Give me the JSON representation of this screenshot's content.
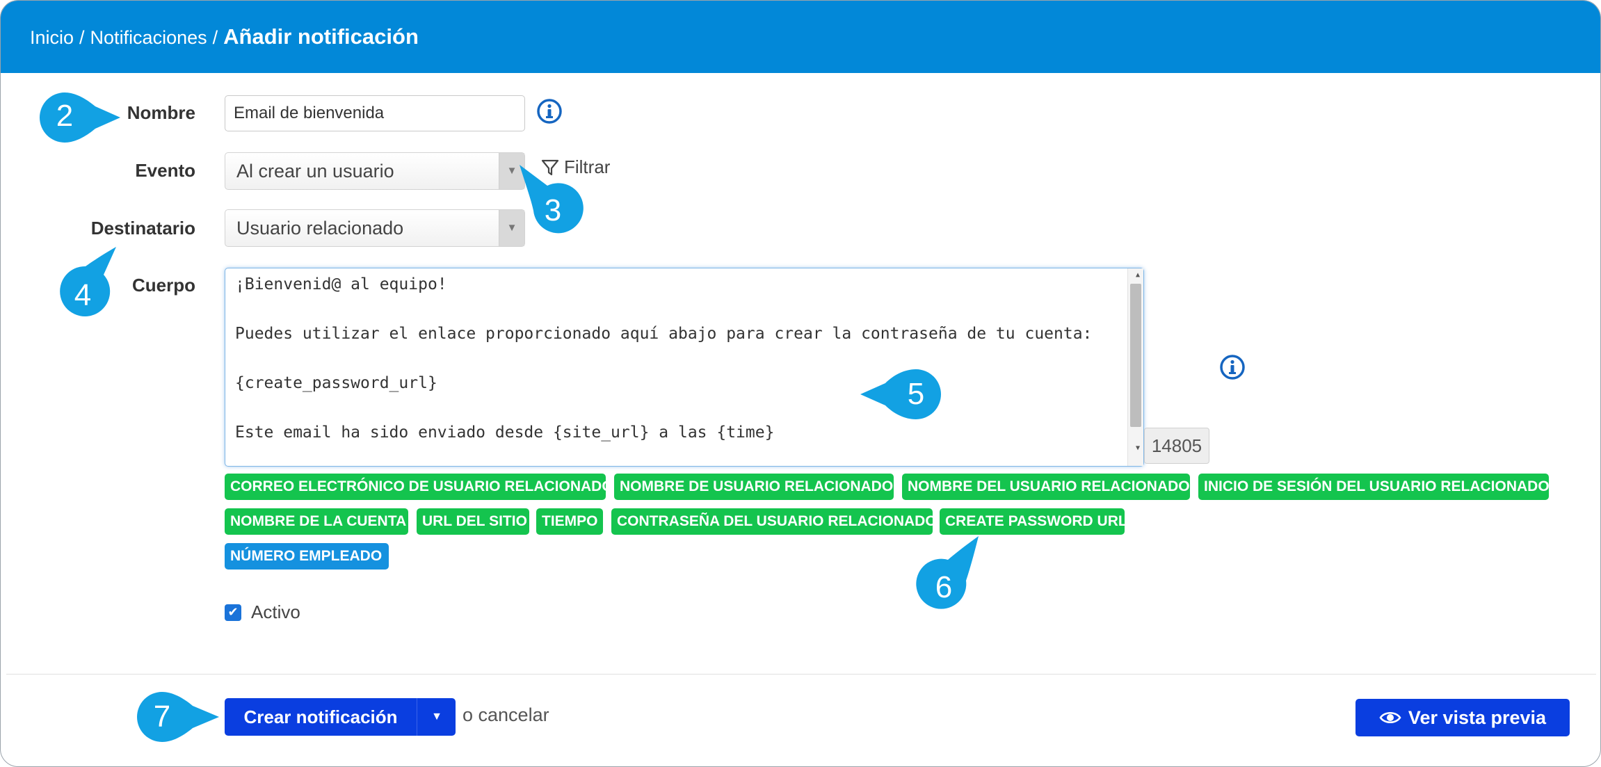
{
  "breadcrumb": {
    "home": "Inicio",
    "section": "Notificaciones",
    "separator": "/",
    "current": "Añadir notificación"
  },
  "form": {
    "name": {
      "label": "Nombre",
      "value": "Email de bienvenida"
    },
    "event": {
      "label": "Evento",
      "value": "Al crear un usuario",
      "filter_label": "Filtrar"
    },
    "recipient": {
      "label": "Destinatario",
      "value": "Usuario relacionado"
    },
    "body": {
      "label": "Cuerpo",
      "lines": [
        "¡Bienvenid@ al equipo!",
        "Puedes utilizar el enlace proporcionado aquí abajo para crear la contraseña de tu cuenta:",
        "{create_password_url}",
        "Este email ha sido enviado desde {site_url} a las {time}"
      ],
      "char_count": "14805"
    },
    "tags": [
      "CORREO ELECTRÓNICO DE USUARIO RELACIONADO",
      "NOMBRE DE USUARIO RELACIONADO",
      "NOMBRE DEL USUARIO RELACIONADO",
      "INICIO DE SESIÓN DEL USUARIO RELACIONADO",
      "NOMBRE DE LA CUENTA",
      "URL DEL SITIO",
      "TIEMPO",
      "CONTRASEÑA DEL USUARIO RELACIONADO",
      "CREATE PASSWORD URL",
      "NÚMERO EMPLEADO"
    ],
    "active": {
      "label": "Activo",
      "checked": true
    }
  },
  "footer": {
    "create_label": "Crear notificación",
    "cancel_label": "o cancelar",
    "preview_label": "Ver vista previa"
  },
  "callouts": [
    "2",
    "3",
    "4",
    "5",
    "6",
    "7"
  ],
  "colors": {
    "header": "#0288d8",
    "tag_green": "#14c44e",
    "tag_blue": "#1591df",
    "primary_button": "#0a3ee0",
    "callout": "#12a1e3",
    "info_icon": "#1565c0"
  },
  "icons": {
    "info": "info-circle-icon",
    "filter": "filter-funnel-icon",
    "dropdown": "caret-down-icon",
    "preview": "eye-icon",
    "checkbox": "check-icon"
  }
}
